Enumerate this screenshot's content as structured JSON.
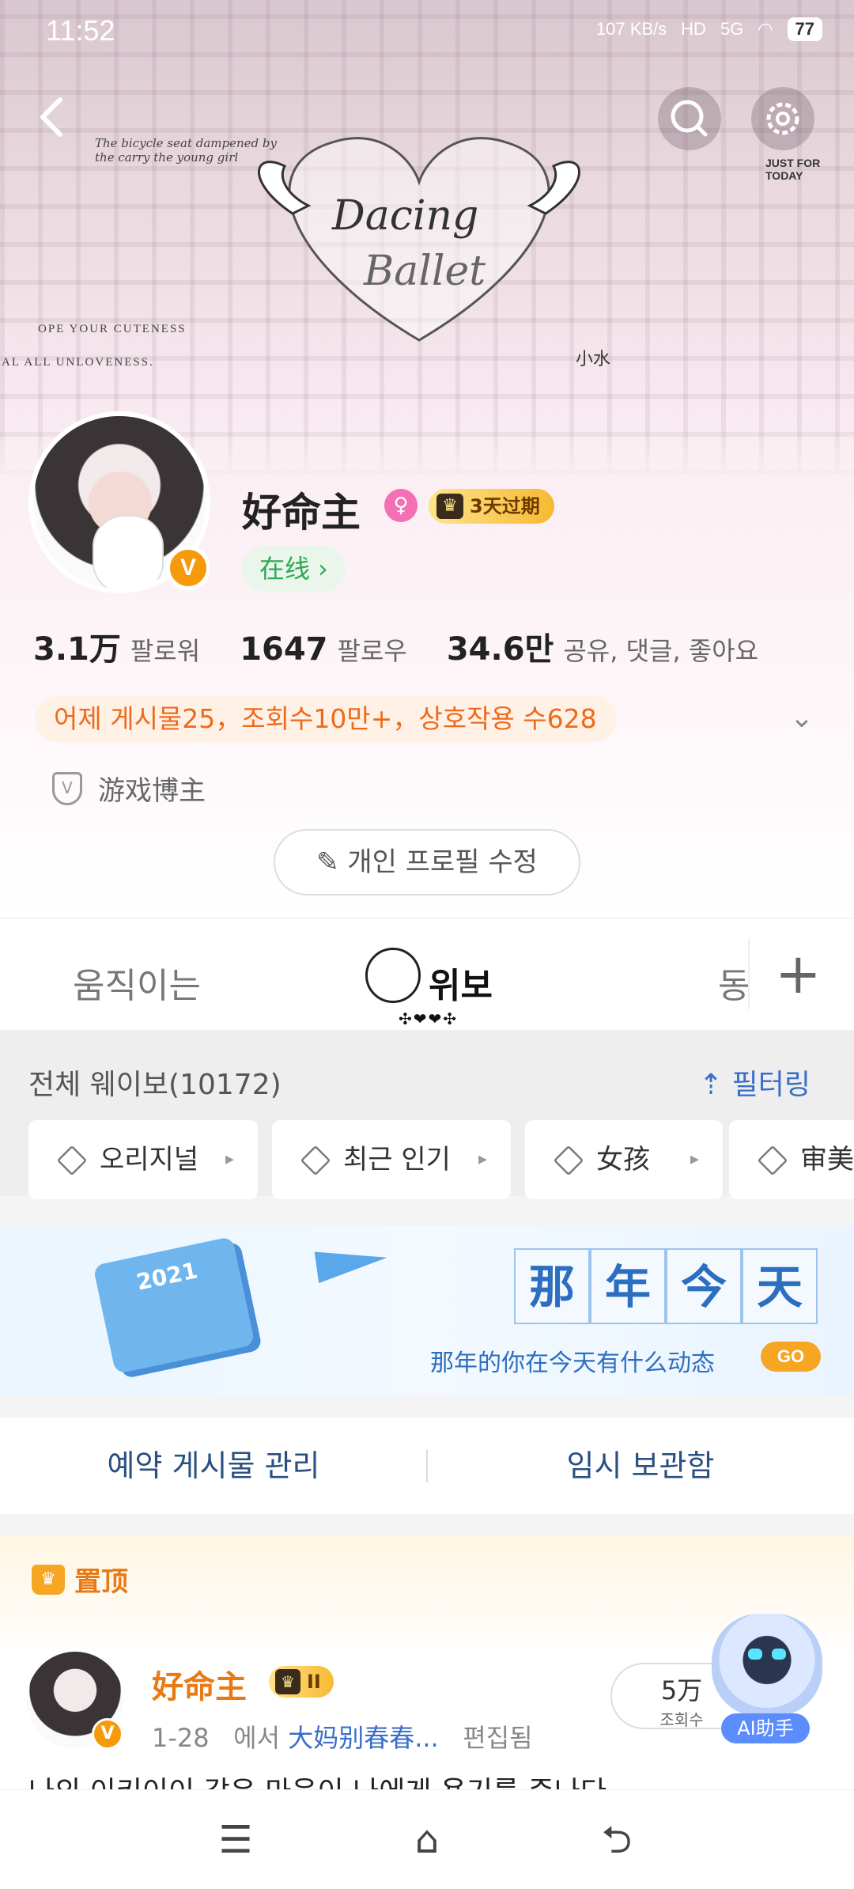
{
  "status_bar": {
    "time": "11:52",
    "net_speed": "107 KB/s",
    "hd": "HD",
    "network": "5G",
    "battery": "77"
  },
  "banner": {
    "decor_text_1": "Dacing",
    "decor_text_2": "Ballet",
    "decor_caption": "The bicycle seat dampened by the carry the young girl",
    "just_for_today": "JUST FOR TODAY",
    "cuteness": "OPE YOUR CUTENESS",
    "unloveness": "AL ALL UNLOVENESS.",
    "small_label": "小水"
  },
  "profile": {
    "username": "好命主",
    "vip_label": "3天过期",
    "online_label": "在线 ›",
    "verified_badge": "V"
  },
  "stats": [
    {
      "value": "3.1万",
      "label": "팔로워"
    },
    {
      "value": "1647",
      "label": "팔로우"
    },
    {
      "value": "34.6만",
      "label": "공유, 댓글, 좋아요"
    }
  ],
  "activity": "어제 게시물25，조회수10만+，상호작용 수628",
  "tag": "游戏博主",
  "edit_profile": "개인 프로필 수정",
  "tabs": [
    {
      "label": "움직이는"
    },
    {
      "label": "위보"
    },
    {
      "label": "동"
    }
  ],
  "tab_indicator": "✣❤❤✣",
  "filters": {
    "count_label": "전체 웨이보(10172)",
    "filter_label": "필터링",
    "chips": [
      "오리지널",
      "최근 인기",
      "女孩",
      "审美"
    ]
  },
  "memory": {
    "year": "2021",
    "title_chars": [
      "那",
      "年",
      "今",
      "天"
    ],
    "subtitle": "那年的你在今天有什么动态",
    "go": "GO"
  },
  "manage": {
    "scheduled": "예약 게시물 관리",
    "drafts": "임시 보관함"
  },
  "post": {
    "pinned_label": "置顶",
    "author": "好命主",
    "vip_level": "II",
    "date": "1-28",
    "via": "에서",
    "source": "大妈别春春...",
    "edited": "편집됨",
    "views_num": "5万",
    "views_label": "조회수",
    "text": "나의 이키이이 같은 마음이 나에게 용기를 준나다"
  },
  "ai_assistant": "AI助手",
  "colors": {
    "accent_orange": "#ee6a1b",
    "link_blue": "#3a6fc7",
    "online_green": "#2eaa54"
  }
}
